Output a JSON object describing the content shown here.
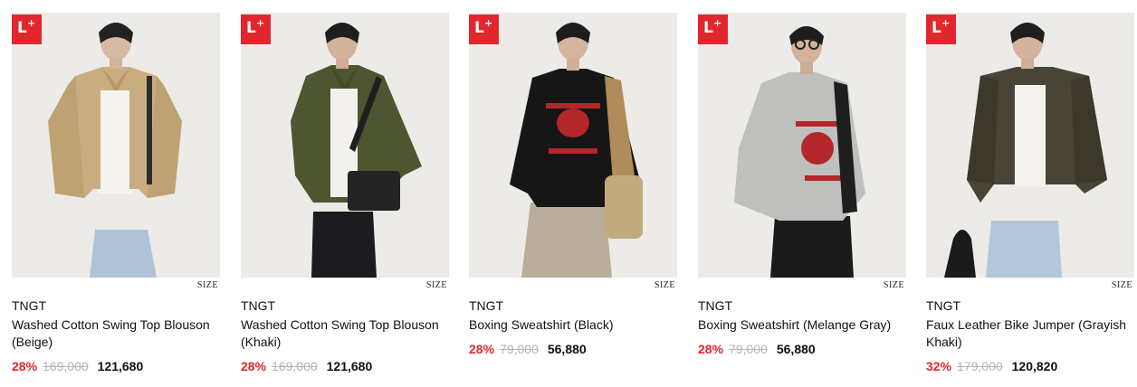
{
  "badge": {
    "letter": "L",
    "plus": "+"
  },
  "size_label": "SIZE",
  "products": [
    {
      "brand": "TNGT",
      "name": "Washed Cotton Swing Top Blouson (Beige)",
      "discount": "28%",
      "original_price": "169,000",
      "sale_price": "121,680"
    },
    {
      "brand": "TNGT",
      "name": "Washed Cotton Swing Top Blouson (Khaki)",
      "discount": "28%",
      "original_price": "169,000",
      "sale_price": "121,680"
    },
    {
      "brand": "TNGT",
      "name": "Boxing Sweatshirt (Black)",
      "discount": "28%",
      "original_price": "79,000",
      "sale_price": "56,880"
    },
    {
      "brand": "TNGT",
      "name": "Boxing Sweatshirt (Melange Gray)",
      "discount": "28%",
      "original_price": "79,000",
      "sale_price": "56,880"
    },
    {
      "brand": "TNGT",
      "name": "Faux Leather Bike Jumper (Grayish Khaki)",
      "discount": "32%",
      "original_price": "179,000",
      "sale_price": "120,820"
    }
  ],
  "colors": {
    "badge": "#e3262e",
    "discount": "#e3262e",
    "original_price": "#b5b5b5"
  }
}
